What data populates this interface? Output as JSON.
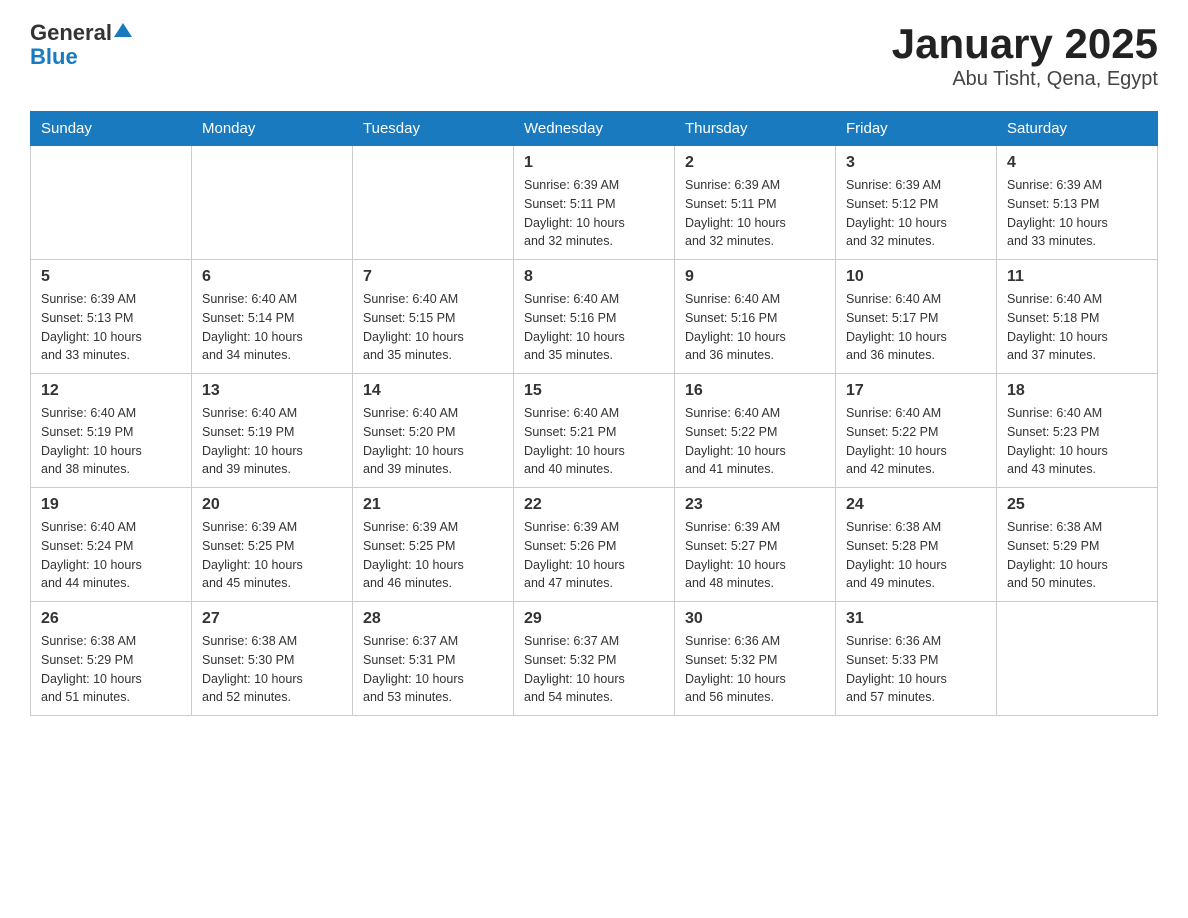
{
  "header": {
    "logo_general": "General",
    "logo_blue": "Blue",
    "month_title": "January 2025",
    "location": "Abu Tisht, Qena, Egypt"
  },
  "weekdays": [
    "Sunday",
    "Monday",
    "Tuesday",
    "Wednesday",
    "Thursday",
    "Friday",
    "Saturday"
  ],
  "weeks": [
    [
      {
        "day": "",
        "info": ""
      },
      {
        "day": "",
        "info": ""
      },
      {
        "day": "",
        "info": ""
      },
      {
        "day": "1",
        "info": "Sunrise: 6:39 AM\nSunset: 5:11 PM\nDaylight: 10 hours\nand 32 minutes."
      },
      {
        "day": "2",
        "info": "Sunrise: 6:39 AM\nSunset: 5:11 PM\nDaylight: 10 hours\nand 32 minutes."
      },
      {
        "day": "3",
        "info": "Sunrise: 6:39 AM\nSunset: 5:12 PM\nDaylight: 10 hours\nand 32 minutes."
      },
      {
        "day": "4",
        "info": "Sunrise: 6:39 AM\nSunset: 5:13 PM\nDaylight: 10 hours\nand 33 minutes."
      }
    ],
    [
      {
        "day": "5",
        "info": "Sunrise: 6:39 AM\nSunset: 5:13 PM\nDaylight: 10 hours\nand 33 minutes."
      },
      {
        "day": "6",
        "info": "Sunrise: 6:40 AM\nSunset: 5:14 PM\nDaylight: 10 hours\nand 34 minutes."
      },
      {
        "day": "7",
        "info": "Sunrise: 6:40 AM\nSunset: 5:15 PM\nDaylight: 10 hours\nand 35 minutes."
      },
      {
        "day": "8",
        "info": "Sunrise: 6:40 AM\nSunset: 5:16 PM\nDaylight: 10 hours\nand 35 minutes."
      },
      {
        "day": "9",
        "info": "Sunrise: 6:40 AM\nSunset: 5:16 PM\nDaylight: 10 hours\nand 36 minutes."
      },
      {
        "day": "10",
        "info": "Sunrise: 6:40 AM\nSunset: 5:17 PM\nDaylight: 10 hours\nand 36 minutes."
      },
      {
        "day": "11",
        "info": "Sunrise: 6:40 AM\nSunset: 5:18 PM\nDaylight: 10 hours\nand 37 minutes."
      }
    ],
    [
      {
        "day": "12",
        "info": "Sunrise: 6:40 AM\nSunset: 5:19 PM\nDaylight: 10 hours\nand 38 minutes."
      },
      {
        "day": "13",
        "info": "Sunrise: 6:40 AM\nSunset: 5:19 PM\nDaylight: 10 hours\nand 39 minutes."
      },
      {
        "day": "14",
        "info": "Sunrise: 6:40 AM\nSunset: 5:20 PM\nDaylight: 10 hours\nand 39 minutes."
      },
      {
        "day": "15",
        "info": "Sunrise: 6:40 AM\nSunset: 5:21 PM\nDaylight: 10 hours\nand 40 minutes."
      },
      {
        "day": "16",
        "info": "Sunrise: 6:40 AM\nSunset: 5:22 PM\nDaylight: 10 hours\nand 41 minutes."
      },
      {
        "day": "17",
        "info": "Sunrise: 6:40 AM\nSunset: 5:22 PM\nDaylight: 10 hours\nand 42 minutes."
      },
      {
        "day": "18",
        "info": "Sunrise: 6:40 AM\nSunset: 5:23 PM\nDaylight: 10 hours\nand 43 minutes."
      }
    ],
    [
      {
        "day": "19",
        "info": "Sunrise: 6:40 AM\nSunset: 5:24 PM\nDaylight: 10 hours\nand 44 minutes."
      },
      {
        "day": "20",
        "info": "Sunrise: 6:39 AM\nSunset: 5:25 PM\nDaylight: 10 hours\nand 45 minutes."
      },
      {
        "day": "21",
        "info": "Sunrise: 6:39 AM\nSunset: 5:25 PM\nDaylight: 10 hours\nand 46 minutes."
      },
      {
        "day": "22",
        "info": "Sunrise: 6:39 AM\nSunset: 5:26 PM\nDaylight: 10 hours\nand 47 minutes."
      },
      {
        "day": "23",
        "info": "Sunrise: 6:39 AM\nSunset: 5:27 PM\nDaylight: 10 hours\nand 48 minutes."
      },
      {
        "day": "24",
        "info": "Sunrise: 6:38 AM\nSunset: 5:28 PM\nDaylight: 10 hours\nand 49 minutes."
      },
      {
        "day": "25",
        "info": "Sunrise: 6:38 AM\nSunset: 5:29 PM\nDaylight: 10 hours\nand 50 minutes."
      }
    ],
    [
      {
        "day": "26",
        "info": "Sunrise: 6:38 AM\nSunset: 5:29 PM\nDaylight: 10 hours\nand 51 minutes."
      },
      {
        "day": "27",
        "info": "Sunrise: 6:38 AM\nSunset: 5:30 PM\nDaylight: 10 hours\nand 52 minutes."
      },
      {
        "day": "28",
        "info": "Sunrise: 6:37 AM\nSunset: 5:31 PM\nDaylight: 10 hours\nand 53 minutes."
      },
      {
        "day": "29",
        "info": "Sunrise: 6:37 AM\nSunset: 5:32 PM\nDaylight: 10 hours\nand 54 minutes."
      },
      {
        "day": "30",
        "info": "Sunrise: 6:36 AM\nSunset: 5:32 PM\nDaylight: 10 hours\nand 56 minutes."
      },
      {
        "day": "31",
        "info": "Sunrise: 6:36 AM\nSunset: 5:33 PM\nDaylight: 10 hours\nand 57 minutes."
      },
      {
        "day": "",
        "info": ""
      }
    ]
  ]
}
